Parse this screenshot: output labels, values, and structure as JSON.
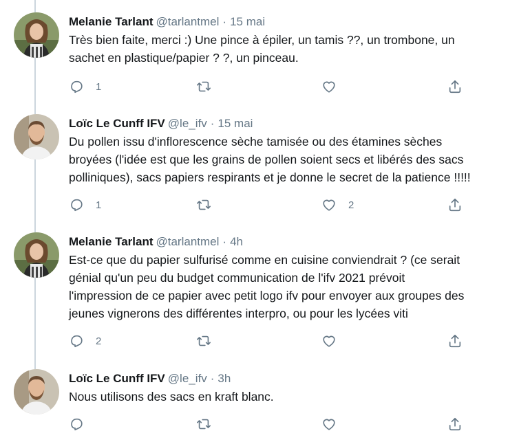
{
  "tweets": [
    {
      "name": "Melanie Tarlant",
      "handle": "@tarlantmel",
      "separator": "·",
      "time": "15 mai",
      "text": "Très bien faite, merci :) Une pince à épiler, un tamis ??, un trombone, un\nsachet en plastique/papier ? ?, un pinceau.",
      "reply_count": "1",
      "retweet_count": "",
      "like_count": "",
      "avatar": "melanie-avatar"
    },
    {
      "name": "Loïc Le Cunff IFV",
      "handle": "@le_ifv",
      "separator": "·",
      "time": "15 mai",
      "text": "Du pollen issu d'inflorescence sèche tamisée ou des étamines sèches\nbroyées (l'idée est que les grains de pollen soient secs et libérés des sacs\npolliniques), sacs papiers respirants et je donne le secret de la patience !!!!!",
      "reply_count": "1",
      "retweet_count": "",
      "like_count": "2",
      "avatar": "loic-avatar"
    },
    {
      "name": "Melanie Tarlant",
      "handle": "@tarlantmel",
      "separator": "·",
      "time": "4h",
      "text": "Est-ce que du papier sulfurisé comme en cuisine conviendrait ? (ce serait\ngénial qu'un peu du budget communication de l'ifv 2021 prévoit\nl'impression de ce papier avec petit logo ifv pour envoyer aux groupes des\njeunes vignerons des différentes interpro, ou pour les lycées viti",
      "reply_count": "2",
      "retweet_count": "",
      "like_count": "",
      "avatar": "melanie-avatar"
    },
    {
      "name": "Loïc Le Cunff IFV",
      "handle": "@le_ifv",
      "separator": "·",
      "time": "3h",
      "text": "Nous utilisons des sacs en kraft blanc.",
      "reply_count": "",
      "retweet_count": "",
      "like_count": "",
      "avatar": "loic-avatar"
    }
  ],
  "icons": {
    "reply": "reply-icon",
    "retweet": "retweet-icon",
    "like": "like-icon",
    "share": "share-icon"
  },
  "colors": {
    "text": "#14171a",
    "secondary": "#657786",
    "thread_line": "#ccd6dd"
  }
}
